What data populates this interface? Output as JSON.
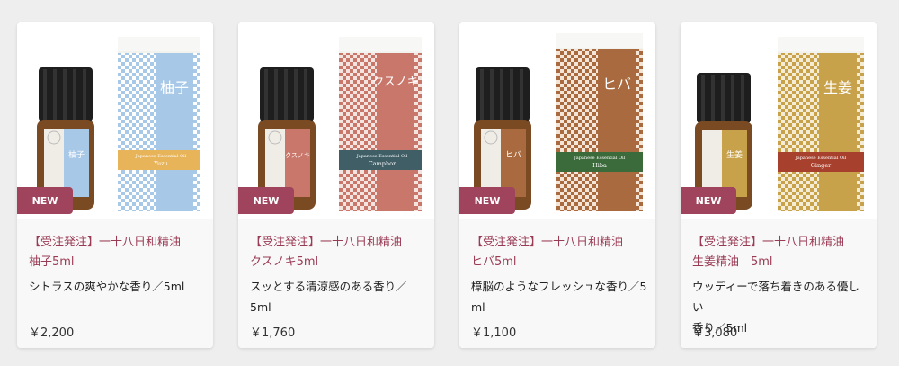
{
  "theme": {
    "badge_color": "#a0435c",
    "title_color": "#9a3b55"
  },
  "products": [
    {
      "badge": "NEW",
      "title_line1": "【受注発注】一十八日和精油",
      "title_line2": "柚子5ml",
      "desc_line1": "シトラスの爽やかな香り／5ml",
      "desc_line2": "",
      "price": "￥2,200",
      "box_color": "#a8c8e8",
      "band_color": "#e8b45a",
      "label_name": "柚子",
      "label_sub": "Japanese Essential Oil",
      "label_en": "Yuzu",
      "bottle_label": "柚子"
    },
    {
      "badge": "NEW",
      "title_line1": "【受注発注】一十八日和精油",
      "title_line2": "クスノキ5ml",
      "desc_line1": "スッとする清涼感のある香り／5ml",
      "desc_line2": "",
      "price": "￥1,760",
      "box_color": "#c9776a",
      "band_color": "#3f5e66",
      "label_name": "クスノキ",
      "label_sub": "Japanese Essential Oil",
      "label_en": "Camphor",
      "bottle_label": "クスノキ"
    },
    {
      "badge": "NEW",
      "title_line1": "【受注発注】一十八日和精油",
      "title_line2": "ヒバ5ml",
      "desc_line1": "樟脳のようなフレッシュな香り／5",
      "desc_line2": "ml",
      "price": "￥1,100",
      "box_color": "#a86a3e",
      "band_color": "#3b6a3b",
      "label_name": "ヒバ",
      "label_sub": "Japanese Essential Oil",
      "label_en": "Hiba",
      "bottle_label": "ヒバ"
    },
    {
      "badge": "NEW",
      "title_line1": "【受注発注】一十八日和精油",
      "title_line2": "生姜精油　5ml",
      "desc_line1": "ウッディーで落ち着きのある優しい",
      "desc_line2": "香り／5ml",
      "price": "￥3,080",
      "box_color": "#c8a24a",
      "band_color": "#a8402e",
      "label_name": "生姜",
      "label_sub": "Japanese Essential Oil",
      "label_en": "Ginger",
      "bottle_label": "生姜"
    }
  ]
}
